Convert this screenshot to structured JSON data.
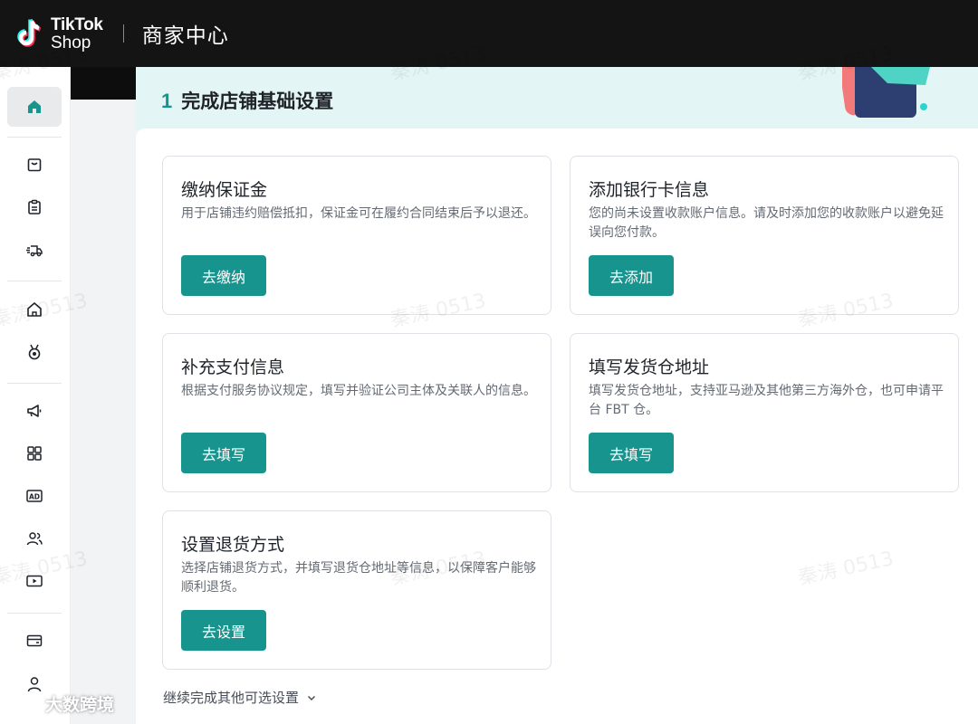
{
  "header": {
    "logo_line1": "TikTok",
    "logo_line2": "Shop",
    "title": "商家中心"
  },
  "sidebar": {
    "items": [
      {
        "icon": "home-icon",
        "active": true
      },
      {
        "icon": "bag-icon"
      },
      {
        "icon": "clipboard-icon"
      },
      {
        "icon": "delivery-truck-icon"
      },
      {
        "icon": "storefront-icon"
      },
      {
        "icon": "medal-icon"
      },
      {
        "icon": "megaphone-icon"
      },
      {
        "icon": "apps-grid-icon"
      },
      {
        "icon": "ad-icon"
      },
      {
        "icon": "users-icon"
      },
      {
        "icon": "video-icon"
      },
      {
        "icon": "wallet-icon"
      },
      {
        "icon": "account-icon"
      }
    ]
  },
  "banner": {
    "step": "1",
    "title": "完成店铺基础设置"
  },
  "cards": [
    {
      "title": "缴纳保证金",
      "desc": "用于店铺违约赔偿抵扣，保证金可在履约合同结束后予以退还。",
      "button": "去缴纳"
    },
    {
      "title": "添加银行卡信息",
      "desc": "您的尚未设置收款账户信息。请及时添加您的收款账户以避免延误向您付款。",
      "button": "去添加"
    },
    {
      "title": "补充支付信息",
      "desc": "根据支付服务协议规定，填写并验证公司主体及关联人的信息。",
      "button": "去填写"
    },
    {
      "title": "填写发货仓地址",
      "desc": "填写发货仓地址，支持亚马逊及其他第三方海外仓，也可申请平台 FBT 仓。",
      "button": "去填写"
    },
    {
      "title": "设置退货方式",
      "desc": "选择店铺退货方式，并填写退货仓地址等信息，以保障客户能够顺利退货。",
      "button": "去设置"
    }
  ],
  "more_link": "继续完成其他可选设置",
  "watermark": "秦涛 0513",
  "overlay_brand": "大数跨境",
  "colors": {
    "accent": "#16948d",
    "topbar": "#141414",
    "banner_bg": "#e3f6f5"
  }
}
